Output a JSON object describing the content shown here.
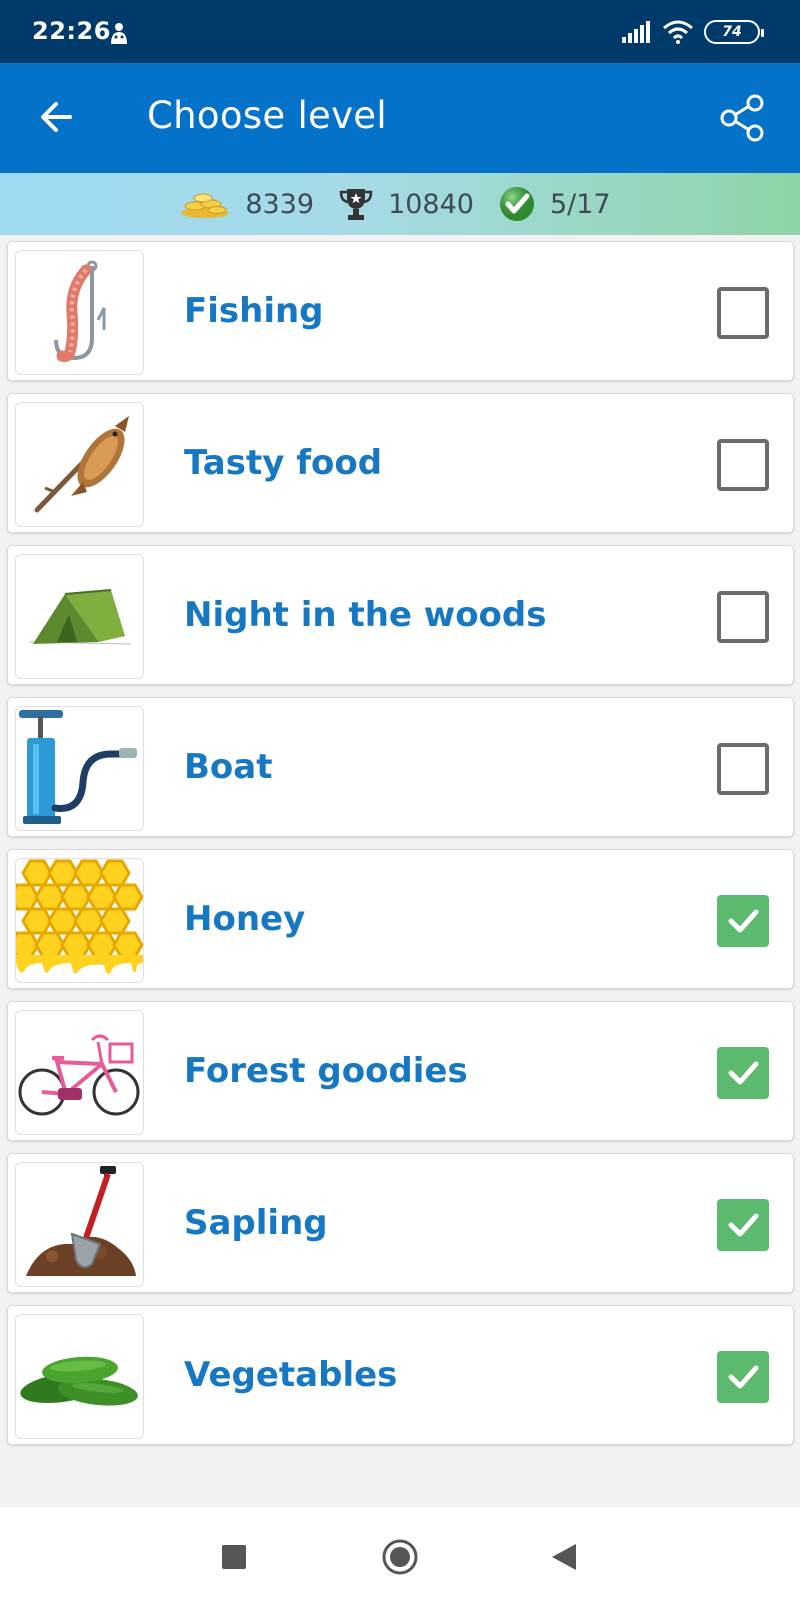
{
  "status_bar": {
    "time": "22:26",
    "battery": "74"
  },
  "app_bar": {
    "title": "Choose level"
  },
  "stats": {
    "coins": "8339",
    "trophies": "10840",
    "completed": "5/17"
  },
  "levels": [
    {
      "name": "Fishing",
      "completed": false,
      "image": "hook-worm-icon"
    },
    {
      "name": "Tasty food",
      "completed": false,
      "image": "fish-on-stick-icon"
    },
    {
      "name": " Night in the woods",
      "completed": false,
      "image": "tent-icon"
    },
    {
      "name": "Boat",
      "completed": false,
      "image": "air-pump-icon"
    },
    {
      "name": "Honey",
      "completed": true,
      "image": "honeycomb-icon"
    },
    {
      "name": " Forest goodies",
      "completed": true,
      "image": "bicycle-icon"
    },
    {
      "name": "Sapling",
      "completed": true,
      "image": "shovel-soil-icon"
    },
    {
      "name": "Vegetables",
      "completed": true,
      "image": "cucumbers-icon"
    }
  ],
  "colors": {
    "status_bar": "#003a6b",
    "app_bar": "#0572c9",
    "level_text": "#1677c2",
    "check_on": "#5cba6e",
    "check_off": "#6b6b6b"
  }
}
